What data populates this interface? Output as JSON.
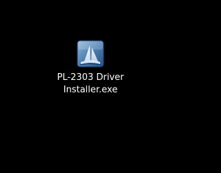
{
  "desktop": {
    "background_color": "#000000",
    "icons": [
      {
        "icon": "installer-exe-icon",
        "label_line1": "PL-2303 Driver",
        "label_line2": "Installer.exe"
      }
    ]
  }
}
